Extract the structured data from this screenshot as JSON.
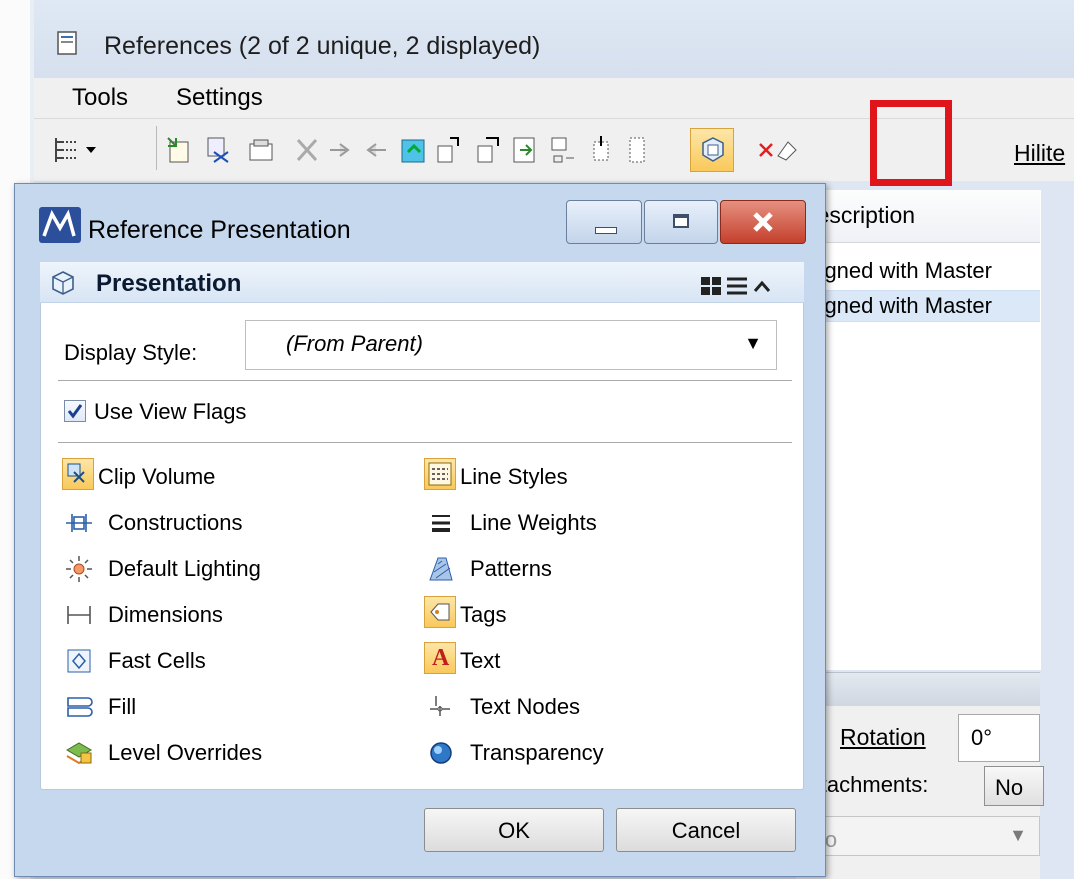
{
  "references_window": {
    "title": "References (2 of 2 unique, 2 displayed)",
    "menu": [
      "Tools",
      "Settings"
    ],
    "toolbar": {
      "hilite_label": "Hilite",
      "highlighted_tool_icon": "presentation-cube-icon"
    },
    "list": {
      "column_header": "Description",
      "rows": [
        "Aligned with Master",
        "Aligned with Master"
      ]
    },
    "properties": {
      "rotation_label": "Rotation",
      "rotation_value": "0°",
      "attachments_label": "Attachments:",
      "attachments_button": "No",
      "combo_value": "No"
    }
  },
  "dialog": {
    "title": "Reference Presentation",
    "panel_title": "Presentation",
    "display_style_label": "Display Style:",
    "display_style_value": "(From Parent)",
    "use_view_flags_label": "Use View Flags",
    "use_view_flags_checked": true,
    "flags_left": [
      {
        "label": "Clip Volume",
        "icon": "clip-volume-icon",
        "active": true
      },
      {
        "label": "Constructions",
        "icon": "constructions-icon",
        "active": false
      },
      {
        "label": "Default Lighting",
        "icon": "lighting-icon",
        "active": false
      },
      {
        "label": "Dimensions",
        "icon": "dimensions-icon",
        "active": false
      },
      {
        "label": "Fast Cells",
        "icon": "fast-cells-icon",
        "active": false
      },
      {
        "label": "Fill",
        "icon": "fill-icon",
        "active": false
      },
      {
        "label": "Level Overrides",
        "icon": "level-overrides-icon",
        "active": false
      }
    ],
    "flags_right": [
      {
        "label": "Line Styles",
        "icon": "line-styles-icon",
        "active": true
      },
      {
        "label": "Line Weights",
        "icon": "line-weights-icon",
        "active": false
      },
      {
        "label": "Patterns",
        "icon": "patterns-icon",
        "active": false
      },
      {
        "label": "Tags",
        "icon": "tags-icon",
        "active": true
      },
      {
        "label": "Text",
        "icon": "text-icon",
        "active": true
      },
      {
        "label": "Text Nodes",
        "icon": "text-nodes-icon",
        "active": false
      },
      {
        "label": "Transparency",
        "icon": "transparency-icon",
        "active": false
      }
    ],
    "ok_label": "OK",
    "cancel_label": "Cancel"
  },
  "colors": {
    "highlight_box": "#e0141b",
    "active_toggle_bg": "#fcd98c",
    "close_button": "#c4402c"
  }
}
